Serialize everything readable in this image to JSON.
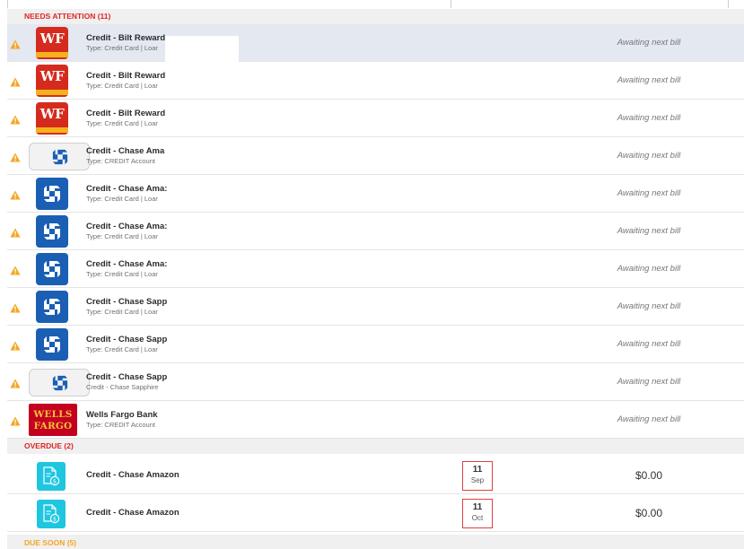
{
  "sections": {
    "needs_attention": {
      "title": "NEEDS ATTENTION (11)",
      "rows": [
        {
          "logo": "wf",
          "name": "Credit - Bilt Reward",
          "type": "Type: Credit Card | Loar",
          "status": "Awaiting next bill",
          "selected": true
        },
        {
          "logo": "wf",
          "name": "Credit - Bilt Reward",
          "type": "Type: Credit Card | Loar",
          "status": "Awaiting next bill"
        },
        {
          "logo": "wf",
          "name": "Credit - Bilt Reward",
          "type": "Type: Credit Card | Loar",
          "status": "Awaiting next bill"
        },
        {
          "logo": "chase-lite",
          "name": "Credit - Chase  Ama",
          "type": "Type: CREDIT   Account",
          "status": "Awaiting next bill"
        },
        {
          "logo": "chase",
          "name": "Credit - Chase Ama:",
          "type": "Type: Credit Card | Loar",
          "status": "Awaiting next bill"
        },
        {
          "logo": "chase",
          "name": "Credit - Chase Ama:",
          "type": "Type: Credit Card | Loar",
          "status": "Awaiting next bill"
        },
        {
          "logo": "chase",
          "name": "Credit - Chase Ama:",
          "type": "Type: Credit Card | Loar",
          "status": "Awaiting next bill"
        },
        {
          "logo": "chase",
          "name": "Credit - Chase Sapp",
          "type": "Type: Credit Card | Loar",
          "status": "Awaiting next bill"
        },
        {
          "logo": "chase",
          "name": "Credit - Chase Sapp",
          "type": "Type: Credit Card | Loar",
          "status": "Awaiting next bill"
        },
        {
          "logo": "chase-lite",
          "name": "Credit - Chase Sapp",
          "type": "Credit - Chase Sapphire",
          "status": "Awaiting next bill"
        },
        {
          "logo": "wfbank",
          "logo_text": [
            "WELLS",
            "FARGO"
          ],
          "name": "Wells Fargo Bank",
          "type": "Type: CREDIT   Account",
          "status": "Awaiting next bill"
        }
      ]
    },
    "overdue": {
      "title": "OVERDUE (2)",
      "rows": [
        {
          "logo": "bill",
          "name": "Credit - Chase  Amazon",
          "due_day": "11",
          "due_month": "Sep",
          "amount": "$0.00"
        },
        {
          "logo": "bill",
          "name": "Credit - Chase  Amazon",
          "due_day": "11",
          "due_month": "Oct",
          "amount": "$0.00"
        }
      ]
    },
    "due_soon": {
      "title": "DUE SOON (5)"
    }
  },
  "logo_text": {
    "wf": "WF",
    "wfbank_line1": "WELLS",
    "wfbank_line2": "FARGO"
  },
  "icons": {
    "warning": "warning-triangle-icon",
    "chase": "chase-octagon-icon",
    "bill": "bill-document-icon"
  },
  "colors": {
    "needs_attention": "#e02424",
    "overdue": "#e02424",
    "due_soon": "#f5a623",
    "warning": "#f5a623",
    "chase": "#1a5fb4",
    "wf": "#d52b1e",
    "bill": "#1fc6e0"
  }
}
